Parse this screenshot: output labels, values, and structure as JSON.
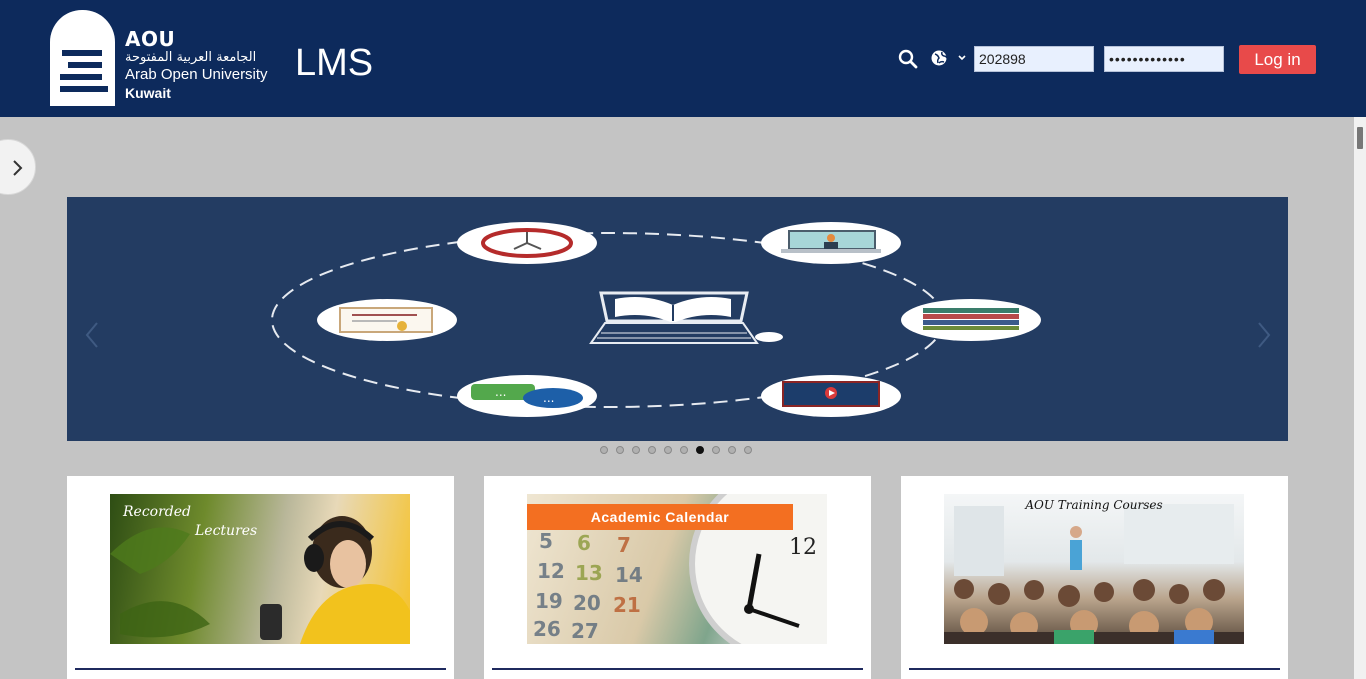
{
  "header": {
    "logo": {
      "short": "AOU",
      "arabic": "الجامعة العربية المفتوحة",
      "english": "Arab Open University",
      "branch": "Kuwait"
    },
    "site_name": "LMS",
    "username_value": "202898",
    "password_value": "•••••••••••••",
    "login_label": "Log in",
    "icons": {
      "search": "search-icon",
      "language": "globe-icon"
    }
  },
  "carousel": {
    "slide_count": 10,
    "active_index": 6,
    "icons": [
      "clock-icon",
      "video-call-icon",
      "certificate-icon",
      "books-icon",
      "chat-icon",
      "video-player-icon",
      "laptop-book-icon"
    ]
  },
  "cards": [
    {
      "line1": "Recorded",
      "line2": "Lectures"
    },
    {
      "label": "Academic Calendar"
    },
    {
      "label": "AOU Training Courses"
    }
  ],
  "colors": {
    "header": "#0d2a5c",
    "login": "#e84a4a",
    "carousel_bg": "#233c62",
    "accent_orange": "#f36f21"
  }
}
